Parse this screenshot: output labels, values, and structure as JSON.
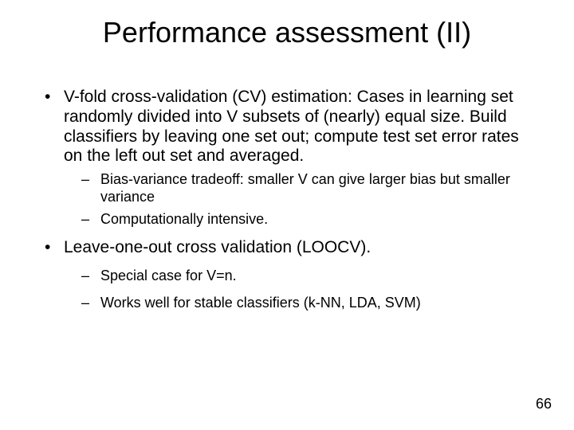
{
  "title": "Performance assessment (II)",
  "bullets": [
    {
      "text": "V-fold cross-validation (CV) estimation: Cases in learning set randomly divided into V subsets of (nearly) equal size. Build classifiers by leaving one set out; compute test set error rates on the left out set and averaged.",
      "sub": [
        "Bias-variance tradeoff:  smaller V can give larger bias but smaller variance",
        "Computationally intensive."
      ]
    },
    {
      "text": "Leave-one-out cross validation (LOOCV).",
      "sub": [
        "Special case for V=n.",
        "Works well for stable classifiers (k-NN, LDA, SVM)"
      ]
    }
  ],
  "page_number": "66"
}
